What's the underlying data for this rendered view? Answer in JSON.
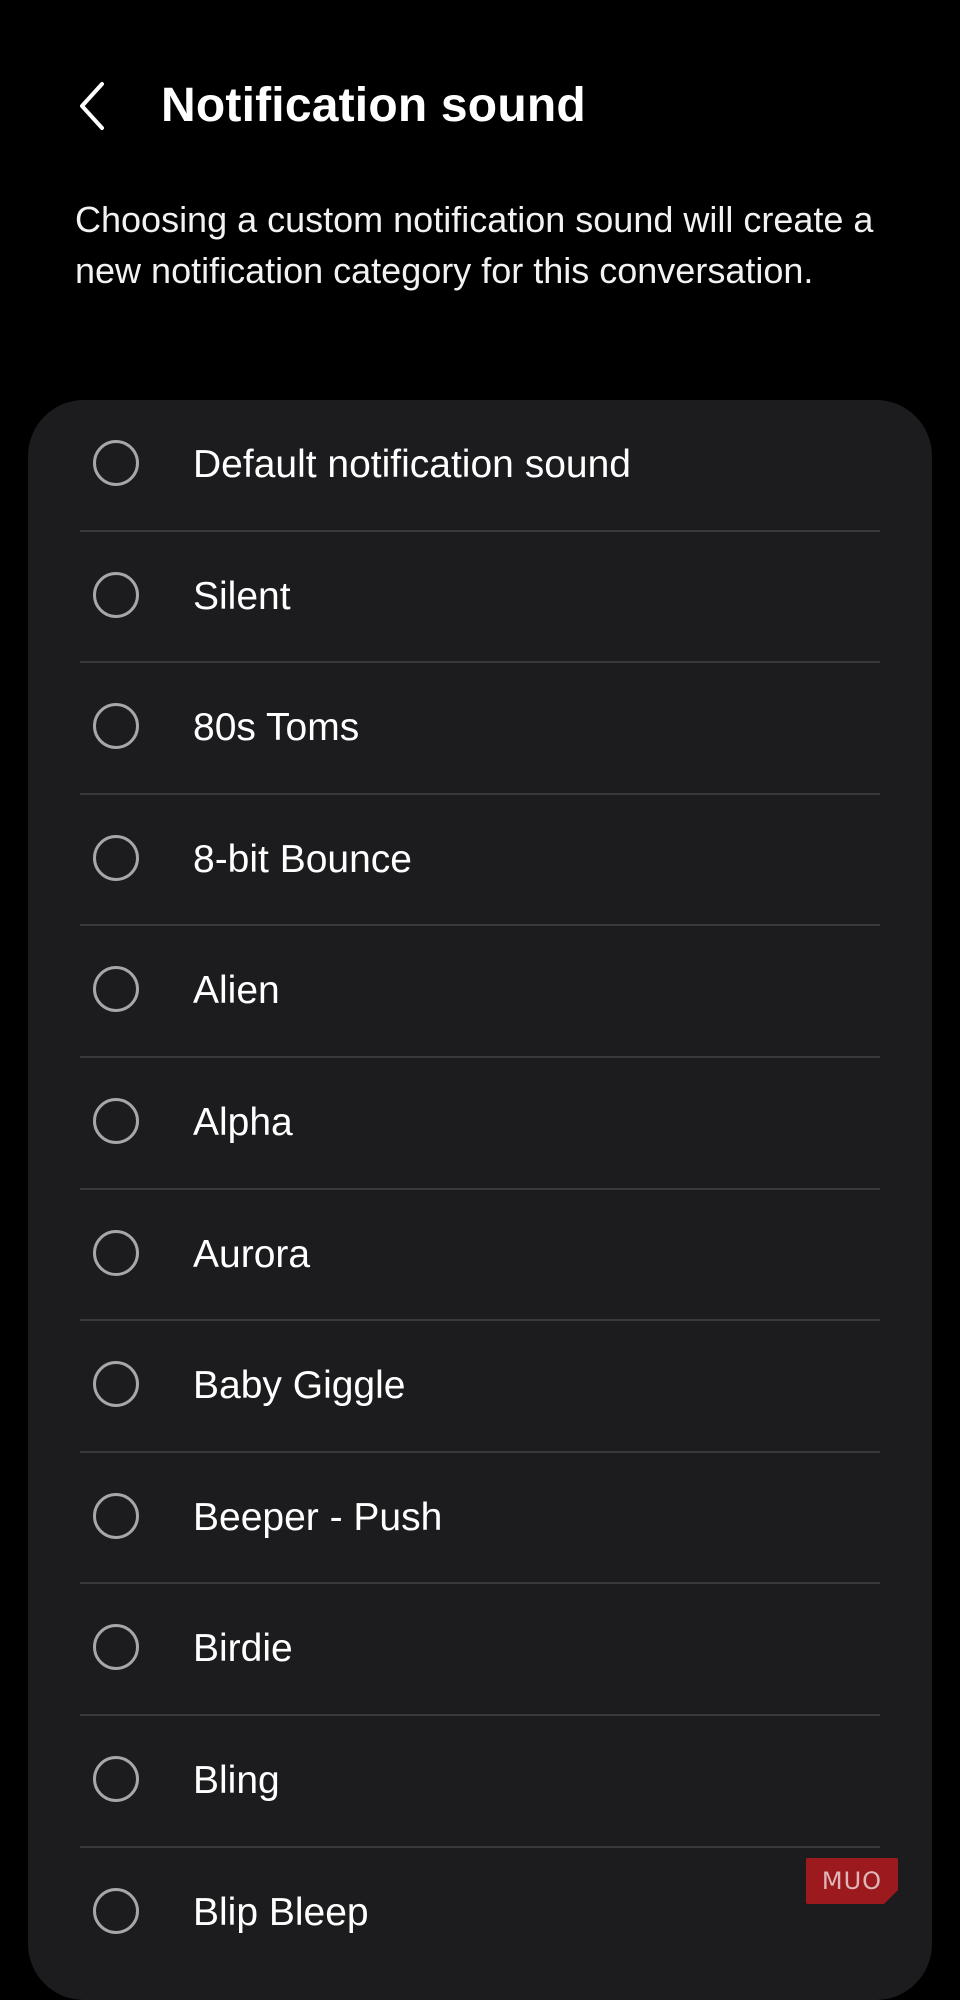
{
  "header": {
    "back_icon": "chevron-left-icon",
    "title": "Notification sound"
  },
  "description": "Choosing a custom notification sound will create a new notification category for this conversation.",
  "sounds": [
    {
      "label": "Default notification sound",
      "selected": false
    },
    {
      "label": "Silent",
      "selected": false
    },
    {
      "label": "80s Toms",
      "selected": false
    },
    {
      "label": "8-bit Bounce",
      "selected": false
    },
    {
      "label": "Alien",
      "selected": false
    },
    {
      "label": "Alpha",
      "selected": false
    },
    {
      "label": "Aurora",
      "selected": false
    },
    {
      "label": "Baby Giggle",
      "selected": false
    },
    {
      "label": "Beeper - Push",
      "selected": false
    },
    {
      "label": "Birdie",
      "selected": false
    },
    {
      "label": "Bling",
      "selected": false
    },
    {
      "label": "Blip Bleep",
      "selected": false
    }
  ],
  "watermark": "MUO",
  "colors": {
    "background": "#000000",
    "card": "#1c1c1e",
    "divider": "#39393c",
    "radio_border": "#a7a7ab",
    "text": "#ffffff",
    "watermark": "#b31a1f"
  }
}
